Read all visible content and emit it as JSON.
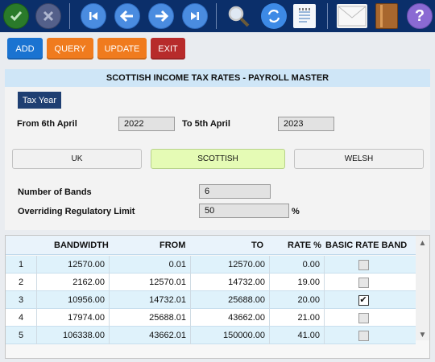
{
  "toolbar": {
    "icons": [
      "confirm-icon",
      "cancel-icon",
      "first-record-icon",
      "previous-record-icon",
      "next-record-icon",
      "last-record-icon",
      "search-icon",
      "refresh-icon",
      "notepad-icon",
      "mail-icon",
      "book-icon",
      "help-icon"
    ],
    "help_glyph": "?"
  },
  "actions": {
    "add": "ADD",
    "query": "QUERY",
    "update": "UPDATE",
    "exit": "EXIT"
  },
  "panel": {
    "title": "SCOTTISH INCOME TAX RATES - PAYROLL MASTER",
    "tax_year_label": "Tax Year",
    "from_label": "From 6th April",
    "from_value": "2022",
    "to_label": "To 5th April",
    "to_value": "2023",
    "tabs": [
      "UK",
      "SCOTTISH",
      "WELSH"
    ],
    "active_tab": "SCOTTISH",
    "bands_label": "Number of Bands",
    "bands_value": "6",
    "limit_label": "Overriding Regulatory Limit",
    "limit_value": "50",
    "limit_unit": "%"
  },
  "grid": {
    "columns": [
      "BANDWIDTH",
      "FROM",
      "TO",
      "RATE %",
      "BASIC RATE BAND"
    ],
    "rows": [
      {
        "n": "1",
        "bandwidth": "12570.00",
        "from": "0.01",
        "to": "12570.00",
        "rate": "0.00",
        "basic": false
      },
      {
        "n": "2",
        "bandwidth": "2162.00",
        "from": "12570.01",
        "to": "14732.00",
        "rate": "19.00",
        "basic": false
      },
      {
        "n": "3",
        "bandwidth": "10956.00",
        "from": "14732.01",
        "to": "25688.00",
        "rate": "20.00",
        "basic": true
      },
      {
        "n": "4",
        "bandwidth": "17974.00",
        "from": "25688.01",
        "to": "43662.00",
        "rate": "21.00",
        "basic": false
      },
      {
        "n": "5",
        "bandwidth": "106338.00",
        "from": "43662.01",
        "to": "150000.00",
        "rate": "41.00",
        "basic": false
      }
    ],
    "check_glyph": "✔"
  },
  "colors": {
    "toolbar_bg": "#0b2f6a",
    "add": "#1a73d1",
    "query": "#f07b1e",
    "update": "#f07b1e",
    "exit": "#b72b2b",
    "active_tab": "#e5fbb5"
  }
}
